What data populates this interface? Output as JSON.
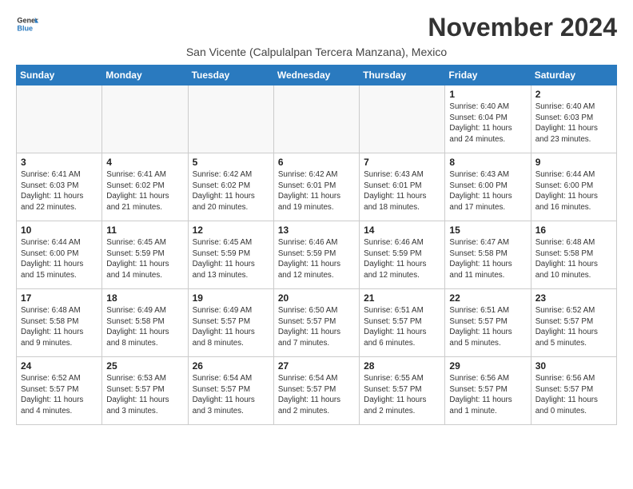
{
  "logo": {
    "line1": "General",
    "line2": "Blue"
  },
  "title": "November 2024",
  "subtitle": "San Vicente (Calpulalpan Tercera Manzana), Mexico",
  "weekdays": [
    "Sunday",
    "Monday",
    "Tuesday",
    "Wednesday",
    "Thursday",
    "Friday",
    "Saturday"
  ],
  "weeks": [
    [
      {
        "day": "",
        "info": ""
      },
      {
        "day": "",
        "info": ""
      },
      {
        "day": "",
        "info": ""
      },
      {
        "day": "",
        "info": ""
      },
      {
        "day": "",
        "info": ""
      },
      {
        "day": "1",
        "info": "Sunrise: 6:40 AM\nSunset: 6:04 PM\nDaylight: 11 hours\nand 24 minutes."
      },
      {
        "day": "2",
        "info": "Sunrise: 6:40 AM\nSunset: 6:03 PM\nDaylight: 11 hours\nand 23 minutes."
      }
    ],
    [
      {
        "day": "3",
        "info": "Sunrise: 6:41 AM\nSunset: 6:03 PM\nDaylight: 11 hours\nand 22 minutes."
      },
      {
        "day": "4",
        "info": "Sunrise: 6:41 AM\nSunset: 6:02 PM\nDaylight: 11 hours\nand 21 minutes."
      },
      {
        "day": "5",
        "info": "Sunrise: 6:42 AM\nSunset: 6:02 PM\nDaylight: 11 hours\nand 20 minutes."
      },
      {
        "day": "6",
        "info": "Sunrise: 6:42 AM\nSunset: 6:01 PM\nDaylight: 11 hours\nand 19 minutes."
      },
      {
        "day": "7",
        "info": "Sunrise: 6:43 AM\nSunset: 6:01 PM\nDaylight: 11 hours\nand 18 minutes."
      },
      {
        "day": "8",
        "info": "Sunrise: 6:43 AM\nSunset: 6:00 PM\nDaylight: 11 hours\nand 17 minutes."
      },
      {
        "day": "9",
        "info": "Sunrise: 6:44 AM\nSunset: 6:00 PM\nDaylight: 11 hours\nand 16 minutes."
      }
    ],
    [
      {
        "day": "10",
        "info": "Sunrise: 6:44 AM\nSunset: 6:00 PM\nDaylight: 11 hours\nand 15 minutes."
      },
      {
        "day": "11",
        "info": "Sunrise: 6:45 AM\nSunset: 5:59 PM\nDaylight: 11 hours\nand 14 minutes."
      },
      {
        "day": "12",
        "info": "Sunrise: 6:45 AM\nSunset: 5:59 PM\nDaylight: 11 hours\nand 13 minutes."
      },
      {
        "day": "13",
        "info": "Sunrise: 6:46 AM\nSunset: 5:59 PM\nDaylight: 11 hours\nand 12 minutes."
      },
      {
        "day": "14",
        "info": "Sunrise: 6:46 AM\nSunset: 5:59 PM\nDaylight: 11 hours\nand 12 minutes."
      },
      {
        "day": "15",
        "info": "Sunrise: 6:47 AM\nSunset: 5:58 PM\nDaylight: 11 hours\nand 11 minutes."
      },
      {
        "day": "16",
        "info": "Sunrise: 6:48 AM\nSunset: 5:58 PM\nDaylight: 11 hours\nand 10 minutes."
      }
    ],
    [
      {
        "day": "17",
        "info": "Sunrise: 6:48 AM\nSunset: 5:58 PM\nDaylight: 11 hours\nand 9 minutes."
      },
      {
        "day": "18",
        "info": "Sunrise: 6:49 AM\nSunset: 5:58 PM\nDaylight: 11 hours\nand 8 minutes."
      },
      {
        "day": "19",
        "info": "Sunrise: 6:49 AM\nSunset: 5:57 PM\nDaylight: 11 hours\nand 8 minutes."
      },
      {
        "day": "20",
        "info": "Sunrise: 6:50 AM\nSunset: 5:57 PM\nDaylight: 11 hours\nand 7 minutes."
      },
      {
        "day": "21",
        "info": "Sunrise: 6:51 AM\nSunset: 5:57 PM\nDaylight: 11 hours\nand 6 minutes."
      },
      {
        "day": "22",
        "info": "Sunrise: 6:51 AM\nSunset: 5:57 PM\nDaylight: 11 hours\nand 5 minutes."
      },
      {
        "day": "23",
        "info": "Sunrise: 6:52 AM\nSunset: 5:57 PM\nDaylight: 11 hours\nand 5 minutes."
      }
    ],
    [
      {
        "day": "24",
        "info": "Sunrise: 6:52 AM\nSunset: 5:57 PM\nDaylight: 11 hours\nand 4 minutes."
      },
      {
        "day": "25",
        "info": "Sunrise: 6:53 AM\nSunset: 5:57 PM\nDaylight: 11 hours\nand 3 minutes."
      },
      {
        "day": "26",
        "info": "Sunrise: 6:54 AM\nSunset: 5:57 PM\nDaylight: 11 hours\nand 3 minutes."
      },
      {
        "day": "27",
        "info": "Sunrise: 6:54 AM\nSunset: 5:57 PM\nDaylight: 11 hours\nand 2 minutes."
      },
      {
        "day": "28",
        "info": "Sunrise: 6:55 AM\nSunset: 5:57 PM\nDaylight: 11 hours\nand 2 minutes."
      },
      {
        "day": "29",
        "info": "Sunrise: 6:56 AM\nSunset: 5:57 PM\nDaylight: 11 hours\nand 1 minute."
      },
      {
        "day": "30",
        "info": "Sunrise: 6:56 AM\nSunset: 5:57 PM\nDaylight: 11 hours\nand 0 minutes."
      }
    ]
  ]
}
